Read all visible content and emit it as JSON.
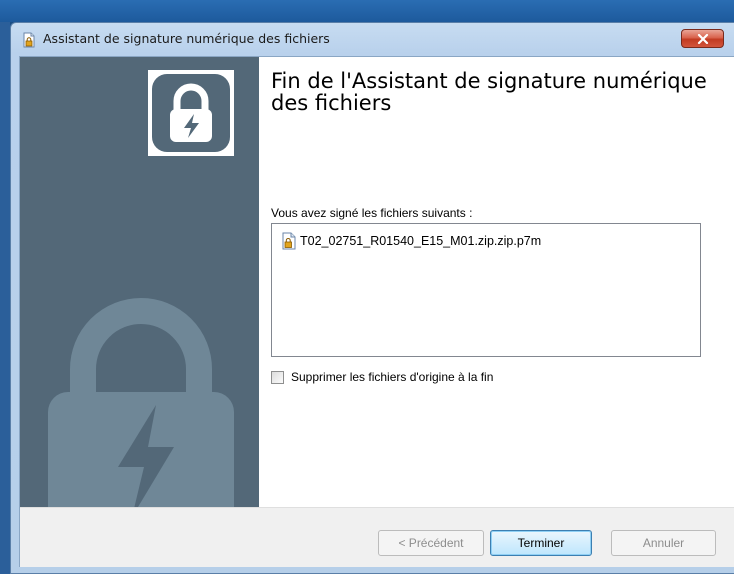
{
  "window": {
    "title": "Assistant de signature numérique des fichiers"
  },
  "wizard": {
    "heading": "Fin de l'Assistant de signature numérique des fichiers",
    "files_label": "Vous avez signé les fichiers suivants :",
    "files": [
      {
        "name": "T02_02751_R01540_E15_M01.zip.zip.p7m",
        "icon": "signed-file-icon"
      }
    ],
    "delete_originals": {
      "label": "Supprimer les fichiers d'origine à la fin",
      "checked": false
    }
  },
  "buttons": {
    "previous": "< Précédent",
    "finish": "Terminer",
    "cancel": "Annuler"
  },
  "colors": {
    "banner": "#536878",
    "banner_lock": "#6f8797",
    "close_button": "#c9442a"
  }
}
